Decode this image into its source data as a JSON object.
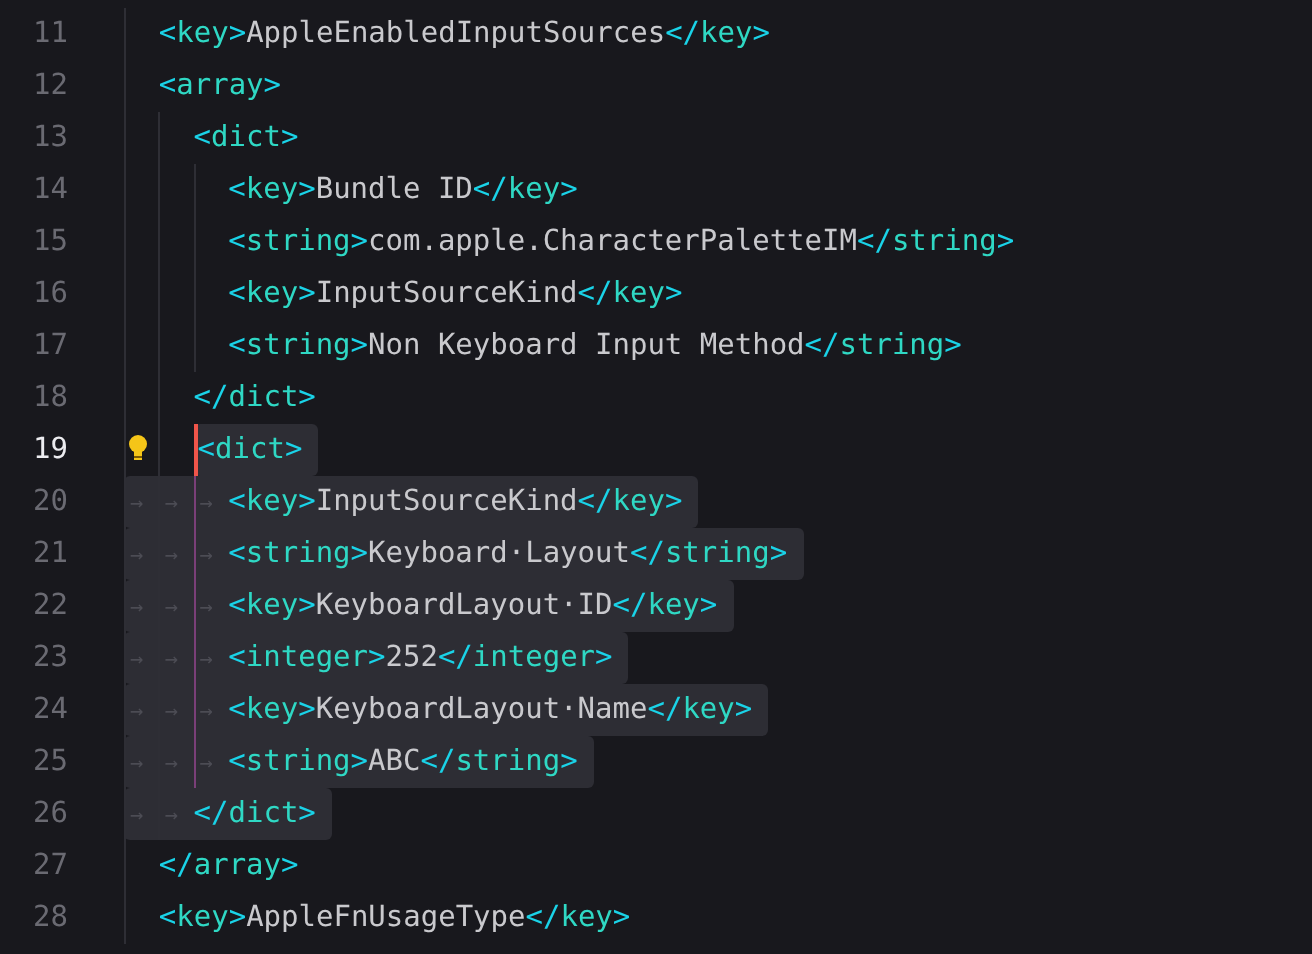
{
  "editor": {
    "lines": [
      {
        "number": "11",
        "selected": false,
        "tokens": [
          {
            "kind": "tag",
            "text": "<key>"
          },
          {
            "kind": "text",
            "text": "AppleEnabledInputSources"
          },
          {
            "kind": "tag",
            "text": "</key>"
          }
        ]
      },
      {
        "number": "12",
        "selected": false,
        "tokens": [
          {
            "kind": "tag",
            "text": "<array>"
          }
        ],
        "children": [
          {
            "number": "13",
            "selected": false,
            "tokens": [
              {
                "kind": "tag",
                "text": "<dict>"
              }
            ],
            "children": [
              {
                "number": "14",
                "selected": false,
                "tokens": [
                  {
                    "kind": "tag",
                    "text": "<key>"
                  },
                  {
                    "kind": "text",
                    "text": "Bundle ID"
                  },
                  {
                    "kind": "tag",
                    "text": "</key>"
                  }
                ]
              },
              {
                "number": "15",
                "selected": false,
                "tokens": [
                  {
                    "kind": "tag",
                    "text": "<string>"
                  },
                  {
                    "kind": "text",
                    "text": "com.apple.CharacterPaletteIM"
                  },
                  {
                    "kind": "tag",
                    "text": "</string>"
                  }
                ]
              },
              {
                "number": "16",
                "selected": false,
                "tokens": [
                  {
                    "kind": "tag",
                    "text": "<key>"
                  },
                  {
                    "kind": "text",
                    "text": "InputSourceKind"
                  },
                  {
                    "kind": "tag",
                    "text": "</key>"
                  }
                ]
              },
              {
                "number": "17",
                "selected": false,
                "tokens": [
                  {
                    "kind": "tag",
                    "text": "<string>"
                  },
                  {
                    "kind": "text",
                    "text": "Non Keyboard Input Method"
                  },
                  {
                    "kind": "tag",
                    "text": "</string>"
                  }
                ]
              }
            ]
          },
          {
            "number": "18",
            "selected": false,
            "tokens": [
              {
                "kind": "tag",
                "text": "</dict>"
              }
            ]
          },
          {
            "number": "19",
            "current": true,
            "selected": true,
            "cursor": true,
            "hint": true,
            "tokens": [
              {
                "kind": "tag",
                "text": "<dict>"
              }
            ],
            "children": [
              {
                "number": "20",
                "selected": true,
                "scope": true,
                "tokens": [
                  {
                    "kind": "tab-marker",
                    "text": "→"
                  },
                  {
                    "kind": "tab-marker",
                    "text": "→"
                  },
                  {
                    "kind": "tab-marker",
                    "text": "→"
                  },
                  {
                    "kind": "tag",
                    "text": "<key>"
                  },
                  {
                    "kind": "text",
                    "text": "InputSourceKind"
                  },
                  {
                    "kind": "tag",
                    "text": "</key>"
                  }
                ]
              },
              {
                "number": "21",
                "selected": true,
                "scope": true,
                "tokens": [
                  {
                    "kind": "tab-marker",
                    "text": "→"
                  },
                  {
                    "kind": "tab-marker",
                    "text": "→"
                  },
                  {
                    "kind": "tab-marker",
                    "text": "→"
                  },
                  {
                    "kind": "tag",
                    "text": "<string>"
                  },
                  {
                    "kind": "text",
                    "text": "Keyboard·Layout"
                  },
                  {
                    "kind": "tag",
                    "text": "</string>"
                  }
                ]
              },
              {
                "number": "22",
                "selected": true,
                "scope": true,
                "tokens": [
                  {
                    "kind": "tab-marker",
                    "text": "→"
                  },
                  {
                    "kind": "tab-marker",
                    "text": "→"
                  },
                  {
                    "kind": "tab-marker",
                    "text": "→"
                  },
                  {
                    "kind": "tag",
                    "text": "<key>"
                  },
                  {
                    "kind": "text",
                    "text": "KeyboardLayout·ID"
                  },
                  {
                    "kind": "tag",
                    "text": "</key>"
                  }
                ]
              },
              {
                "number": "23",
                "selected": true,
                "scope": true,
                "tokens": [
                  {
                    "kind": "tab-marker",
                    "text": "→"
                  },
                  {
                    "kind": "tab-marker",
                    "text": "→"
                  },
                  {
                    "kind": "tab-marker",
                    "text": "→"
                  },
                  {
                    "kind": "tag",
                    "text": "<integer>"
                  },
                  {
                    "kind": "text",
                    "text": "252"
                  },
                  {
                    "kind": "tag",
                    "text": "</integer>"
                  }
                ]
              },
              {
                "number": "24",
                "selected": true,
                "scope": true,
                "tokens": [
                  {
                    "kind": "tab-marker",
                    "text": "→"
                  },
                  {
                    "kind": "tab-marker",
                    "text": "→"
                  },
                  {
                    "kind": "tab-marker",
                    "text": "→"
                  },
                  {
                    "kind": "tag",
                    "text": "<key>"
                  },
                  {
                    "kind": "text",
                    "text": "KeyboardLayout·Name"
                  },
                  {
                    "kind": "tag",
                    "text": "</key>"
                  }
                ]
              },
              {
                "number": "25",
                "selected": true,
                "scope": true,
                "tokens": [
                  {
                    "kind": "tab-marker",
                    "text": "→"
                  },
                  {
                    "kind": "tab-marker",
                    "text": "→"
                  },
                  {
                    "kind": "tab-marker",
                    "text": "→"
                  },
                  {
                    "kind": "tag",
                    "text": "<string>"
                  },
                  {
                    "kind": "text",
                    "text": "ABC"
                  },
                  {
                    "kind": "tag",
                    "text": "</string>"
                  }
                ]
              }
            ]
          },
          {
            "number": "26",
            "selected": true,
            "tokens": [
              {
                "kind": "tab-marker",
                "text": "→"
              },
              {
                "kind": "tab-marker",
                "text": "→"
              },
              {
                "kind": "tag",
                "text": "</dict>"
              }
            ]
          }
        ]
      },
      {
        "number": "27",
        "selected": false,
        "tokens": [
          {
            "kind": "tag",
            "text": "</array>"
          }
        ]
      },
      {
        "number": "28",
        "selected": false,
        "tokens": [
          {
            "kind": "tag",
            "text": "<key>"
          },
          {
            "kind": "text",
            "text": "AppleFnUsageType"
          },
          {
            "kind": "tag",
            "text": "</key>"
          }
        ]
      }
    ]
  }
}
